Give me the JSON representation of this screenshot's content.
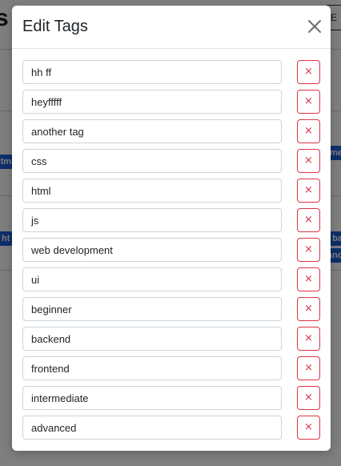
{
  "background": {
    "title_partial": "s",
    "right_button_partial": "E",
    "pills": [
      "htm",
      "me",
      "ht",
      "ba",
      "anc"
    ]
  },
  "modal": {
    "title": "Edit Tags",
    "close_icon": "close-icon",
    "remove_glyph": "×",
    "tags": [
      "hh ff",
      "heyfffff",
      "another tag",
      "css",
      "html",
      "js",
      "web development",
      "ui",
      "beginner",
      "backend",
      "frontend",
      "intermediate",
      "advanced"
    ]
  },
  "colors": {
    "danger": "#dc3545",
    "backdrop": "#7d7d7d",
    "pill": "#1f5fd6"
  }
}
